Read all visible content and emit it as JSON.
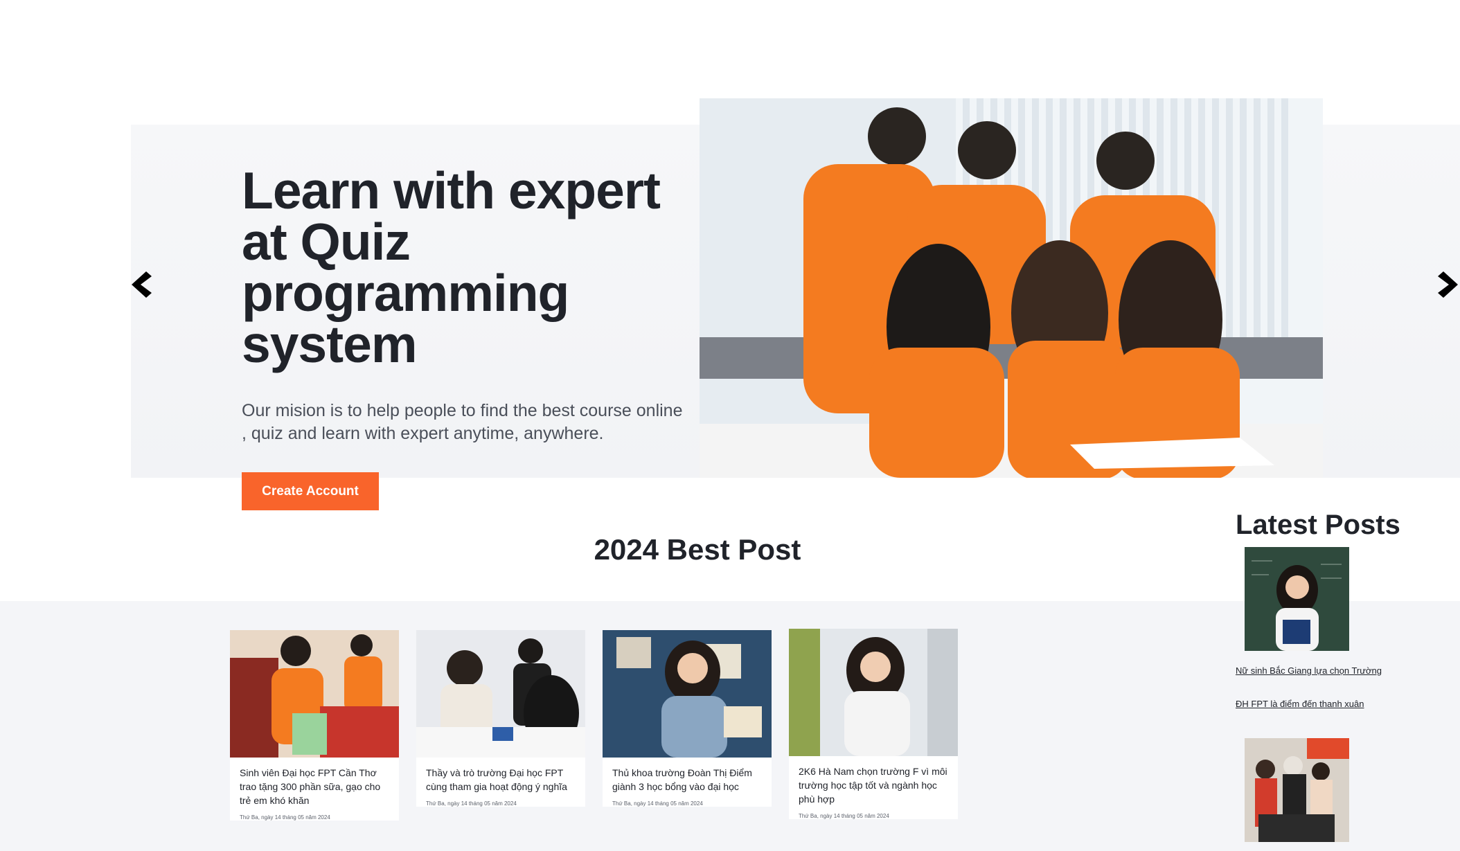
{
  "hero": {
    "title": "Learn with expert at Quiz programming system",
    "subtitle": "Our mision is to help people to find the best course online , quiz and learn with expert anytime, anywhere.",
    "cta_label": "Create Account",
    "prev_icon": "chevron-left-icon",
    "next_icon": "chevron-right-icon",
    "accent_color": "#f9642b"
  },
  "best_posts": {
    "heading": "2024 Best Post",
    "cards": [
      {
        "title": "Sinh viên Đại học FPT Cần Thơ trao tặng 300 phần sữa, gạo cho trẻ em khó khăn",
        "date": "Thứ Ba, ngày 14 tháng 05 năm 2024"
      },
      {
        "title": "Thầy và trò trường Đại học FPT cùng tham gia hoạt động ý nghĩa",
        "date": "Thứ Ba, ngày 14 tháng 05 năm 2024"
      },
      {
        "title": "Thủ khoa trường Đoàn Thị Điểm giành 3 học bổng vào đại học",
        "date": "Thứ Ba, ngày 14 tháng 05 năm 2024"
      },
      {
        "title": "2K6 Hà Nam chọn trường F vì môi trường học tập tốt và ngành học phù hợp",
        "date": "Thứ Ba, ngày 14 tháng 05 năm 2024"
      }
    ]
  },
  "latest_posts": {
    "heading": "Latest Posts",
    "items": [
      {
        "line1": "Nữ sinh Bắc Giang lựa chọn Trường",
        "line2": "ĐH FPT là điểm đến thanh xuân"
      }
    ]
  }
}
